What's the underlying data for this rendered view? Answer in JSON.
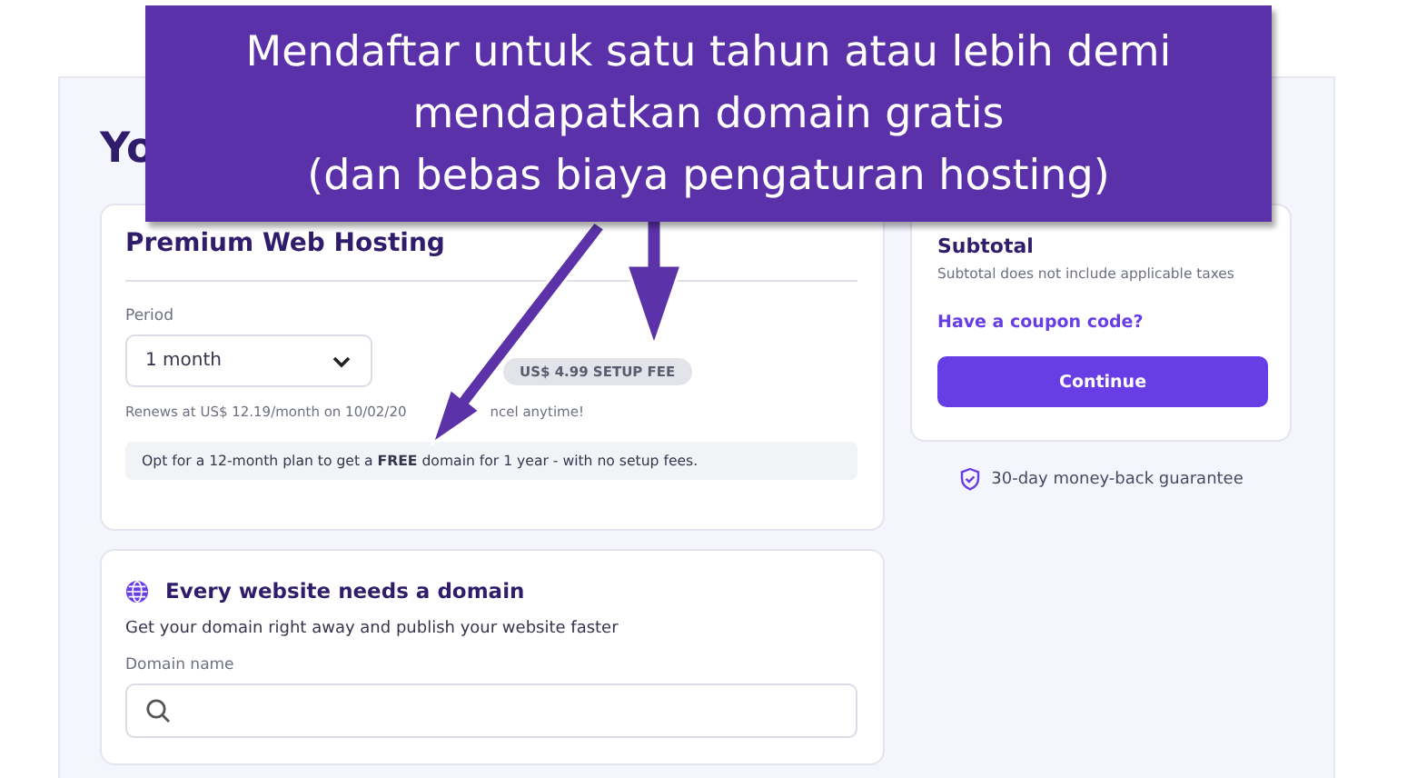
{
  "page_heading": "Yo",
  "hosting_card": {
    "title": "Premium Web Hosting",
    "period_label": "Period",
    "period_value": "1 month",
    "setup_fee_badge": "US$ 4.99 SETUP FEE",
    "renewal_note_parts": [
      "Renews at US$ 12.19/month on 10/02/20",
      "ncel anytime!"
    ],
    "promo_note": "Opt for a 12-month plan to get a **FREE** domain for 1 year - with no setup fees."
  },
  "domain_card": {
    "title": "Every website needs a domain",
    "subtitle": "Get your domain right away and publish your website faster",
    "field_label": "Domain name"
  },
  "summary_card": {
    "title": "Subtotal",
    "note": "Subtotal does not include applicable taxes",
    "coupon_link": "Have a coupon code?",
    "continue_button": "Continue"
  },
  "guarantee": "30-day money-back guarantee",
  "callout": {
    "lines": [
      "Mendaftar untuk satu tahun atau lebih demi",
      "mendapatkan domain gratis",
      "(dan bebas biaya pengaturan hosting)"
    ]
  }
}
